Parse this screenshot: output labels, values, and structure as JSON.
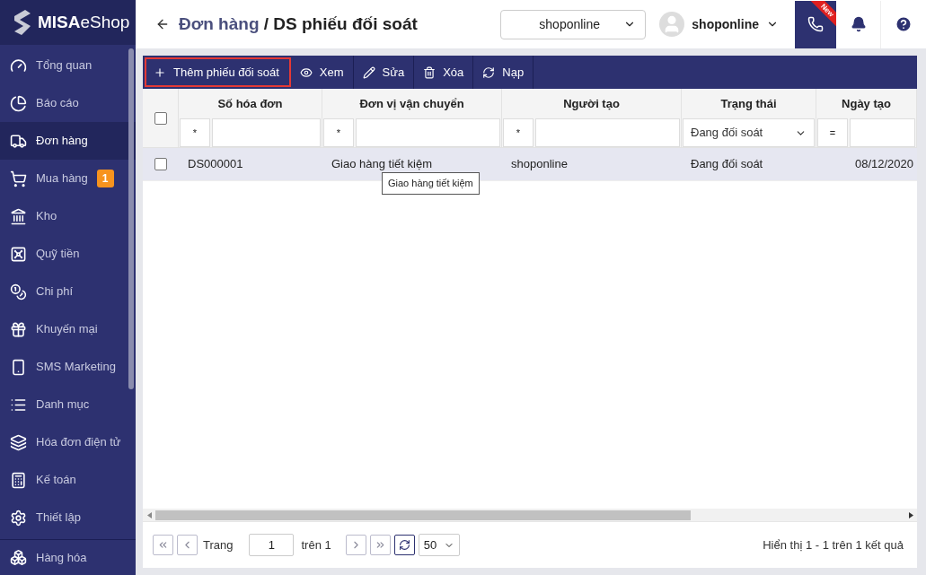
{
  "brand": {
    "strong": "MISA",
    "light": "eShop"
  },
  "sidebar": {
    "items": [
      {
        "label": "Tổng quan",
        "selected": false
      },
      {
        "label": "Báo cáo",
        "selected": false
      },
      {
        "label": "Đơn hàng",
        "selected": true
      },
      {
        "label": "Mua hàng",
        "selected": false,
        "badge": "1"
      },
      {
        "label": "Kho",
        "selected": false
      },
      {
        "label": "Quỹ tiền",
        "selected": false
      },
      {
        "label": "Chi phí",
        "selected": false
      },
      {
        "label": "Khuyến mại",
        "selected": false
      },
      {
        "label": "SMS Marketing",
        "selected": false
      },
      {
        "label": "Danh mục",
        "selected": false
      },
      {
        "label": "Hóa đơn điện tử",
        "selected": false
      },
      {
        "label": "Kế toán",
        "selected": false
      },
      {
        "label": "Thiết lập",
        "selected": false
      }
    ],
    "footer_item": {
      "label": "Hàng hóa"
    }
  },
  "header": {
    "breadcrumb": {
      "parent": "Đơn hàng",
      "separator": "/",
      "current": "DS phiếu đối soát"
    },
    "shop_select": {
      "value": "shoponline"
    },
    "user": {
      "name": "shoponline"
    },
    "call_badge": "New"
  },
  "toolbar": [
    {
      "label": "Thêm phiếu đối soát",
      "selected": true
    },
    {
      "label": "Xem",
      "selected": false
    },
    {
      "label": "Sửa",
      "selected": false
    },
    {
      "label": "Xóa",
      "selected": false
    },
    {
      "label": "Nạp",
      "selected": false
    }
  ],
  "table": {
    "header_checked": false,
    "columns": [
      {
        "label": "Số hóa đơn",
        "filter": {
          "kind": "text",
          "operator": "*"
        }
      },
      {
        "label": "Đơn vị vận chuyển",
        "filter": {
          "kind": "text",
          "operator": "*"
        }
      },
      {
        "label": "Người tạo",
        "filter": {
          "kind": "text",
          "operator": "*"
        }
      },
      {
        "label": "Trạng thái",
        "filter": {
          "kind": "select",
          "value": "Đang đối soát"
        }
      },
      {
        "label": "Ngày tạo",
        "filter": {
          "kind": "text",
          "operator": "="
        }
      }
    ],
    "rows": [
      {
        "checked": false,
        "selected": true,
        "cells": [
          "DS000001",
          "Giao hàng tiết kiệm",
          "shoponline",
          "Đang đối soát",
          "08/12/2020"
        ]
      }
    ],
    "tooltip": "Giao hàng tiết kiệm"
  },
  "pagination": {
    "page_label": "Trang",
    "page": "1",
    "of": "trên 1",
    "page_size": "50",
    "summary": "Hiển thị 1 - 1 trên 1 kết quả"
  }
}
